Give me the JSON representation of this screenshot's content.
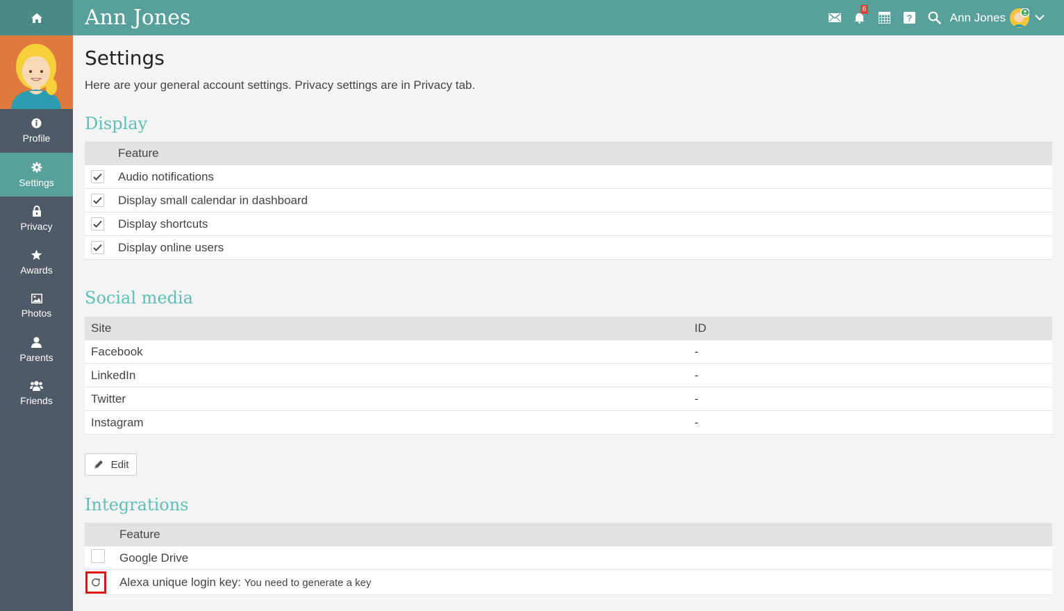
{
  "header": {
    "title": "Ann Jones",
    "notification_count": "6",
    "user_name": "Ann Jones",
    "home_icon": "home-icon",
    "icons": [
      "mail-icon",
      "bell-icon",
      "calendar-icon",
      "help-icon",
      "search-icon",
      "chevron-down-icon"
    ]
  },
  "sidebar": {
    "items": [
      {
        "label": "Profile",
        "icon": "info-icon"
      },
      {
        "label": "Settings",
        "icon": "gear-icon",
        "active": true
      },
      {
        "label": "Privacy",
        "icon": "lock-icon"
      },
      {
        "label": "Awards",
        "icon": "star-icon"
      },
      {
        "label": "Photos",
        "icon": "image-icon"
      },
      {
        "label": "Parents",
        "icon": "user-icon"
      },
      {
        "label": "Friends",
        "icon": "users-icon"
      }
    ]
  },
  "page": {
    "title": "Settings",
    "intro": "Here are your general account settings. Privacy settings are in Privacy tab."
  },
  "display": {
    "title": "Display",
    "header_feature": "Feature",
    "rows": [
      {
        "label": "Audio notifications",
        "checked": true
      },
      {
        "label": "Display small calendar in dashboard",
        "checked": true
      },
      {
        "label": "Display shortcuts",
        "checked": true
      },
      {
        "label": "Display online users",
        "checked": true
      }
    ]
  },
  "social": {
    "title": "Social media",
    "header_site": "Site",
    "header_id": "ID",
    "rows": [
      {
        "site": "Facebook",
        "id": "-"
      },
      {
        "site": "LinkedIn",
        "id": "-"
      },
      {
        "site": "Twitter",
        "id": "-"
      },
      {
        "site": "Instagram",
        "id": "-"
      }
    ],
    "edit_label": "Edit"
  },
  "integrations": {
    "title": "Integrations",
    "header_feature": "Feature",
    "rows": [
      {
        "label": "Google Drive",
        "checked": false
      },
      {
        "label": "Alexa unique login key:",
        "note": "You need to generate a key"
      }
    ]
  },
  "colors": {
    "topbar": "#57a09b",
    "sidebar": "#4e5a65",
    "accent": "#5cbfb6",
    "highlight": "#e01010"
  }
}
